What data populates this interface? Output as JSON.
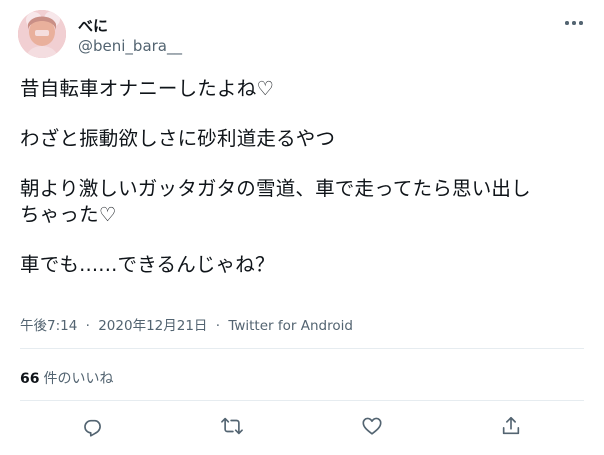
{
  "user": {
    "display_name": "べに",
    "handle": "@beni_bara__"
  },
  "tweet": {
    "lines": [
      "昔自転車オナニーしたよね♡",
      "",
      "わざと振動欲しさに砂利道走るやつ",
      "",
      "朝より激しいガッタガタの雪道、車で走ってたら思い出し",
      "ちゃった♡",
      "",
      "車でも......できるんじゃね？"
    ],
    "time": "午後7:14",
    "date": "2020年12月21日",
    "source": "Twitter for Android",
    "separator": "·"
  },
  "stats": {
    "likes_count": "66",
    "likes_label": "件のいいね"
  },
  "actions": {
    "icons": [
      "reply-icon",
      "retweet-icon",
      "like-icon",
      "share-icon"
    ]
  },
  "colors": {
    "text_primary": "#0f1419",
    "text_secondary": "#536471",
    "divider": "#e6ecf0"
  }
}
